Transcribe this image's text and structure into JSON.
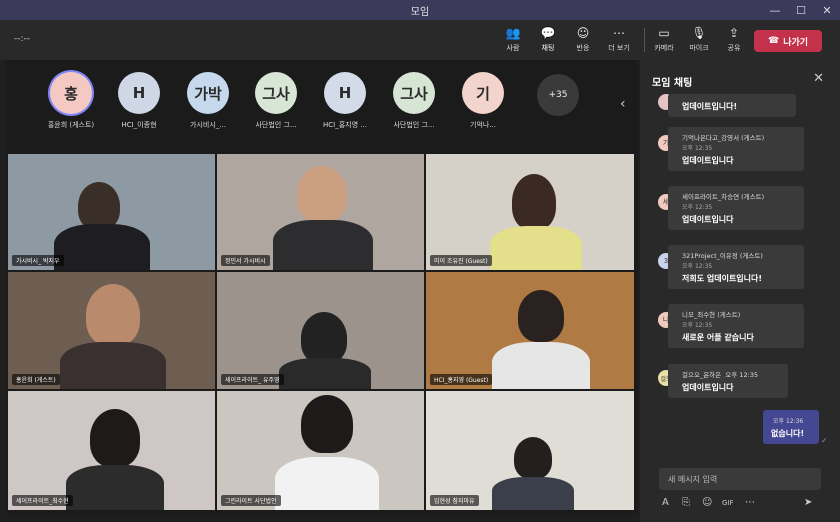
{
  "window": {
    "title": "모임",
    "minimize": "—",
    "maximize": "☐",
    "close": "✕"
  },
  "toolbar": {
    "timer": "--:--",
    "people": "사람",
    "chat": "채팅",
    "react": "반응",
    "more": "더 보기",
    "camera": "카메라",
    "mic": "마이크",
    "share": "공유",
    "leave": "나가기"
  },
  "participants": [
    {
      "initial": "홍",
      "name": "홍윤희 (게스트)",
      "color": "#f4c9c3"
    },
    {
      "initial": "H",
      "name": "HCI_이종현",
      "color": "#cfd6e6"
    },
    {
      "initial": "가박",
      "name": "가시비시_...",
      "color": "#c6d8ec"
    },
    {
      "initial": "그사",
      "name": "사단법인 그...",
      "color": "#d7e6d5"
    },
    {
      "initial": "H",
      "name": "HCI_홍지영 ...",
      "color": "#d3dbe8"
    },
    {
      "initial": "그사",
      "name": "사단법인 그...",
      "color": "#d6e5d4"
    },
    {
      "initial": "기",
      "name": "기억나...",
      "color": "#f3d4cc"
    }
  ],
  "more_participants": "+35",
  "video_tiles": [
    {
      "label": "가시비시_ 박지우"
    },
    {
      "label": "정민서 가시비시"
    },
    {
      "label": "미이 조유진 (Guest)"
    },
    {
      "label": "홍윤희 (게스트)"
    },
    {
      "label": "세이프라이트_ 유주영"
    },
    {
      "label": "HCI_홍지영 (Guest)"
    },
    {
      "label": "세이프라이트_최수현"
    },
    {
      "label": "그린라이트 사단법인"
    },
    {
      "label": "임현성 참지마유"
    }
  ],
  "chat": {
    "title": "모임 채팅",
    "messages": [
      {
        "initial": "",
        "color": "#e8c3c3",
        "who": "",
        "time": "",
        "text": "업데이트입니다!"
      },
      {
        "initial": "기",
        "color": "#f1c9bf",
        "who": "기억나온다고_강영서 (게스트)",
        "time": "오후 12:35",
        "text": "업데이트입니다"
      },
      {
        "initial": "세",
        "color": "#f1c9bf",
        "who": "세이프라이트_차승연 (게스트)",
        "time": "오후 12:35",
        "text": "업데이트입니다"
      },
      {
        "initial": "3",
        "color": "#c9d3ee",
        "who": "321Project_이유정 (게스트)",
        "time": "오후 12:35",
        "text": "저희도 업데이트입니다!"
      },
      {
        "initial": "니",
        "color": "#f1c9bf",
        "who": "니모_최수현 (게스트)",
        "time": "오후 12:35",
        "text": "새로운 어플 같습니다"
      },
      {
        "initial": "걸오",
        "color": "#e8e0a8",
        "who": "걸으오_윤하은",
        "time": "오후 12:35",
        "text": "업데이트입니다"
      }
    ],
    "mine": {
      "time": "오후 12:36",
      "text": "없습니다!"
    },
    "compose_placeholder": "새 메시지 입력"
  }
}
